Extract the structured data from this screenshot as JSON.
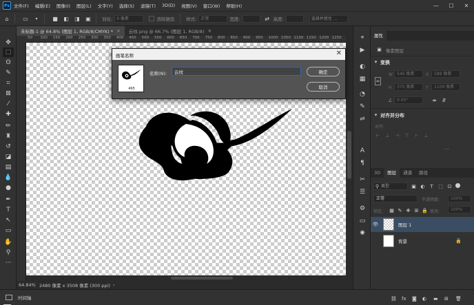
{
  "app": {
    "logo_text": "Ps"
  },
  "menu": {
    "items": [
      "文件(F)",
      "编辑(E)",
      "图像(I)",
      "图层(L)",
      "文字(Y)",
      "选择(S)",
      "滤镜(T)",
      "3D(D)",
      "视图(V)",
      "窗口(W)",
      "帮助(H)"
    ]
  },
  "window_controls": {
    "minimize": "—",
    "maximize": "☐",
    "close": "✕"
  },
  "options_bar": {
    "feather_label": "羽化:",
    "feather_value": "0 像素",
    "antialias_label": "消除锯齿",
    "style_label": "样式:",
    "style_value": "正常",
    "width_label": "宽度:",
    "height_label": "高度:",
    "select_mask_label": "选择并遮住 ..."
  },
  "tabs": [
    {
      "label": "未标题-1 @ 64.8% (图层 1, RGB/8/CMYK) *",
      "close": "×"
    },
    {
      "label": "云纹.png @ 66.7% (图层 1, RGB/8)",
      "close": "×"
    }
  ],
  "rulers": {
    "h_ticks": [
      "50",
      "100",
      "150",
      "200",
      "250",
      "300",
      "350",
      "400",
      "450",
      "500",
      "550",
      "600",
      "650",
      "700",
      "750",
      "800",
      "850",
      "900",
      "950",
      "1000",
      "1050",
      "1100",
      "1150",
      "1200",
      "1250"
    ]
  },
  "status_bar": {
    "zoom": "64.84%",
    "doc_info": "2480 像素 x 3508 像素 (300 ppi)"
  },
  "timeline": {
    "label": "时间轴"
  },
  "dialog": {
    "title": "画笔名称",
    "close": "✕",
    "brush_size": "495",
    "name_label": "名称(N):",
    "name_value": "云纹",
    "ok_label": "确定",
    "cancel_label": "取消"
  },
  "properties_panel": {
    "tab_label": "属性",
    "pixel_layer_label": "像素图层",
    "transform_title": "变换",
    "w_label": "W",
    "w_value": "546 像素",
    "x_label": "X",
    "x_value": "588 像素",
    "h_label": "H",
    "h_value": "375 像素",
    "y_label": "Y",
    "y_value": "1109 像素",
    "angle_value": "0.00°",
    "align_title": "对齐并分布",
    "align_sub": "对齐:"
  },
  "layers_panel": {
    "tabs": [
      "3D",
      "图层",
      "通道",
      "路径"
    ],
    "active_tab": "图层",
    "filter_label": "类型",
    "blend_mode": "正常",
    "opacity_label": "不透明度:",
    "opacity_value": "100%",
    "lock_label": "锁定:",
    "fill_label": "填充:",
    "fill_value": "100%",
    "layers": [
      {
        "name": "图层 1",
        "selected": true
      },
      {
        "name": "背景",
        "selected": false
      }
    ]
  },
  "colors": {
    "accent": "#31a8ff",
    "foreground": "#e02020",
    "background": "#000000",
    "selection": "#3a4d63"
  }
}
